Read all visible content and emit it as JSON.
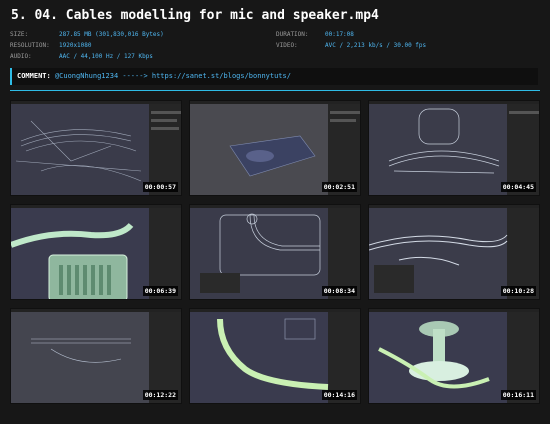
{
  "title": "5. 04. Cables modelling for mic and speaker.mp4",
  "meta": {
    "size_label": "SIZE:",
    "size_value": "287.85 MB (301,830,016 Bytes)",
    "resolution_label": "RESOLUTION:",
    "resolution_value": "1920x1080",
    "audio_label": "AUDIO:",
    "audio_value": "AAC / 44,100 Hz / 127 Kbps",
    "duration_label": "DURATION:",
    "duration_value": "00:17:08",
    "video_label": "VIDEO:",
    "video_value": "AVC / 2,213 kb/s / 30.00 fps"
  },
  "comment": {
    "label": "COMMENT:",
    "text": "@CuongNhung1234 -----> https://sanet.st/blogs/bonnytuts/"
  },
  "thumbnails": [
    {
      "timestamp": "00:00:57",
      "scene": "wireframe-desk"
    },
    {
      "timestamp": "00:02:51",
      "scene": "mic-stand"
    },
    {
      "timestamp": "00:04:45",
      "scene": "cable-closeup"
    },
    {
      "timestamp": "00:06:39",
      "scene": "green-cable-speaker"
    },
    {
      "timestamp": "00:08:34",
      "scene": "cable-bend"
    },
    {
      "timestamp": "00:10:28",
      "scene": "cable-bundle"
    },
    {
      "timestamp": "00:12:22",
      "scene": "cable-top"
    },
    {
      "timestamp": "00:14:16",
      "scene": "green-cable-route"
    },
    {
      "timestamp": "00:16:11",
      "scene": "mic-base"
    }
  ],
  "colors": {
    "accent": "#2fbce6",
    "value_text": "#4fb6f0",
    "background": "#171717"
  }
}
